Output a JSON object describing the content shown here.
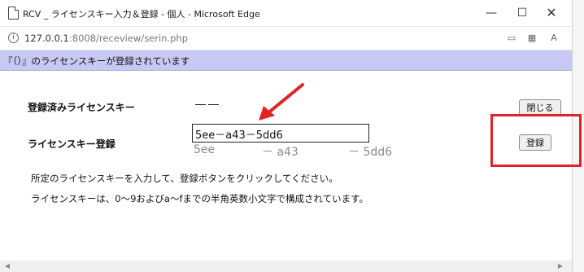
{
  "window": {
    "title": "RCV _ ライセンスキー入力＆登録 - 個人 - Microsoft Edge",
    "controls": {
      "minimize": "—",
      "maximize": "☐",
      "close": "✕"
    }
  },
  "address_bar": {
    "host": "127.0.0.1",
    "path": ":8008/receview/serin.php"
  },
  "banner": {
    "text": "『（）』のライセンスキーが登録されています"
  },
  "form": {
    "registered_label": "登録済みライセンスキー",
    "registered_value": "――",
    "register_label": "ライセンスキー登録",
    "key_input_value": "5ee－a43－5dd6",
    "hints": [
      "5ee",
      "－ a43",
      "－ 5dd6"
    ],
    "close_button": "閉じる",
    "register_button": "登録"
  },
  "description": [
    "所定のライセンスキーを入力して、登録ボタンをクリックしてください。",
    "ライセンスキーは、0～9およびa～fまでの半角英数小文字で構成されています。"
  ],
  "annotation_color": "#e02424",
  "banner_color": "#c8c8f5"
}
